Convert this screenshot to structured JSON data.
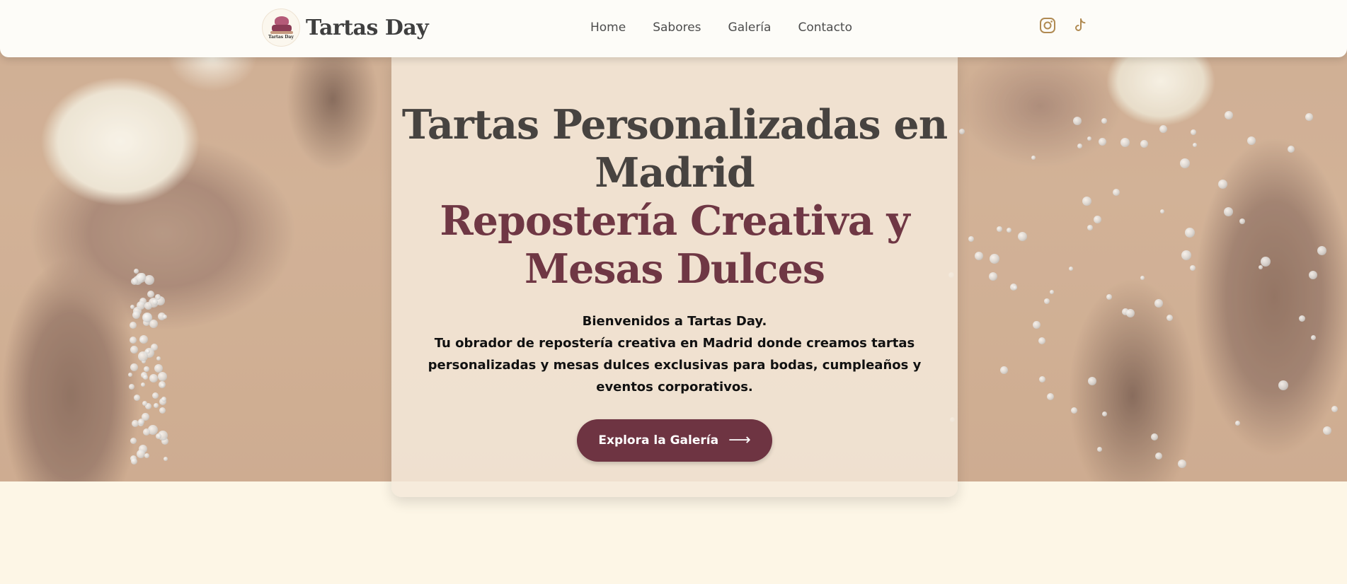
{
  "brand": {
    "name": "Tartas Day",
    "logo_text": "Tartas Day"
  },
  "nav": {
    "items": [
      {
        "label": "Home"
      },
      {
        "label": "Sabores"
      },
      {
        "label": "Galería"
      },
      {
        "label": "Contacto"
      }
    ]
  },
  "social": {
    "icons": [
      "instagram-icon",
      "tiktok-icon"
    ],
    "icon_color": "#b08a52"
  },
  "hero": {
    "title_line1": "Tartas Personalizadas en Madrid",
    "title_line2": "Repostería Creativa y Mesas Dulces",
    "welcome": "Bienvenidos a Tartas Day.",
    "description": "Tu obrador de repostería creativa en Madrid donde creamos tartas personalizadas y mesas dulces exclusivas para bodas, cumpleaños y eventos corporativos.",
    "cta_label": "Explora la Galería",
    "cta_icon": "arrow-right-icon"
  },
  "colors": {
    "accent": "#6e3442",
    "title": "#474340",
    "page_bg": "#fdf6e6"
  }
}
